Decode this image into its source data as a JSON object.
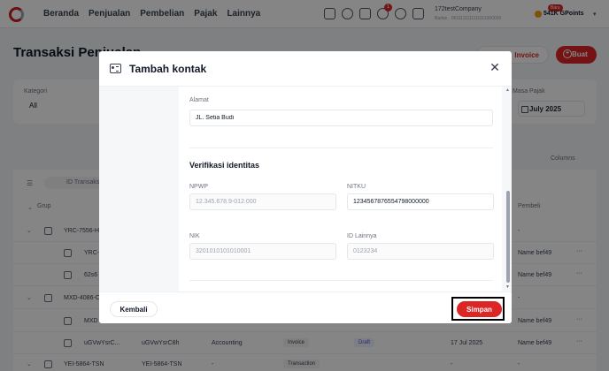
{
  "topnav": {
    "menu": [
      "Beranda",
      "Penjualan",
      "Pembelian",
      "Pajak",
      "Lainnya"
    ],
    "notification_count": "1",
    "company_name": "172testCompany",
    "company_sub": "Badan · 0011111111111111000000",
    "points_badge": "Baru",
    "points": "541K GPoints"
  },
  "page": {
    "title": "Transaksi Penjualan",
    "invoice_button": "Invoice",
    "create_button": "Buat",
    "kategori_label": "Kategori",
    "kategori_value": "All",
    "masa_pajak_label": "Masa Pajak",
    "masa_pajak_value": "July 2025",
    "columns_button": "Columns",
    "id_filter_chip": "ID Transaksi",
    "group_header": "Grup",
    "buyer_header": "Pembeli"
  },
  "table": {
    "rows": [
      {
        "id": "YRC-7556-H",
        "col2": "",
        "col3": "",
        "type": "",
        "status": "",
        "date": "",
        "buyer": "-",
        "group": true
      },
      {
        "id": "YRC-",
        "col2": "",
        "col3": "",
        "type": "",
        "status": "",
        "date": "",
        "buyer": "Name bef49",
        "group": false
      },
      {
        "id": "62s6",
        "col2": "",
        "col3": "",
        "type": "",
        "status": "",
        "date": "",
        "buyer": "Name bef49",
        "group": false
      },
      {
        "id": "MXD-4086-C",
        "col2": "",
        "col3": "",
        "type": "",
        "status": "",
        "date": "",
        "buyer": "-",
        "group": true
      },
      {
        "id": "MXD",
        "col2": "",
        "col3": "",
        "type": "",
        "status": "",
        "date": "",
        "buyer": "Name bef49",
        "group": false
      },
      {
        "id": "uGVwYsrC...",
        "col2": "uGVwYsrC8h",
        "col3": "Accounting",
        "type": "Invoice",
        "status": "Draft",
        "date": "17 Jul 2025",
        "buyer": "Name bef49",
        "group": false
      },
      {
        "id": "YEI-5864-TSN",
        "col2": "YEI-5864-TSN",
        "col3": "-",
        "type": "Transaction",
        "status": "",
        "date": "-",
        "buyer": "-",
        "group": true
      }
    ]
  },
  "modal": {
    "title": "Tambah kontak",
    "alamat_label": "Alamat",
    "alamat_value": "JL. Setia Budi",
    "verification_title": "Verifikasi identitas",
    "npwp_label": "NPWP",
    "npwp_placeholder": "12.345.678.9-012.000",
    "nitku_label": "NITKU",
    "nitku_value": "1234567876554798000000",
    "nik_label": "NIK",
    "nik_placeholder": "3201010101010001",
    "id_lainnya_label": "ID Lainnya",
    "id_lainnya_placeholder": "0123234",
    "back_button": "Kembali",
    "save_button": "Simpan"
  },
  "colors": {
    "brand": "#dc2626",
    "overlay": "rgba(0,0,0,0.48)"
  }
}
